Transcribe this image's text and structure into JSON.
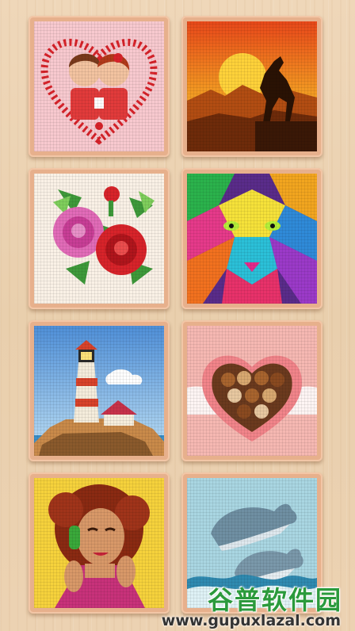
{
  "gallery": {
    "items": [
      {
        "subject": "couple-in-heart",
        "bg": "#f8c9cf"
      },
      {
        "subject": "horse-sunset",
        "bg": "#e2661e"
      },
      {
        "subject": "roses",
        "bg": "#faf1e6"
      },
      {
        "subject": "rainbow-tiger",
        "bg": "#5a2c8a"
      },
      {
        "subject": "lighthouse",
        "bg": "#7fb6e6"
      },
      {
        "subject": "chocolate-heart-box",
        "bg": "#f6b8b2"
      },
      {
        "subject": "woman-with-headphones",
        "bg": "#f6d23c"
      },
      {
        "subject": "dolphins",
        "bg": "#a9d6e2"
      }
    ]
  },
  "watermark": {
    "brand": "谷普软件园",
    "url": "www.gupuxlazal.com"
  }
}
